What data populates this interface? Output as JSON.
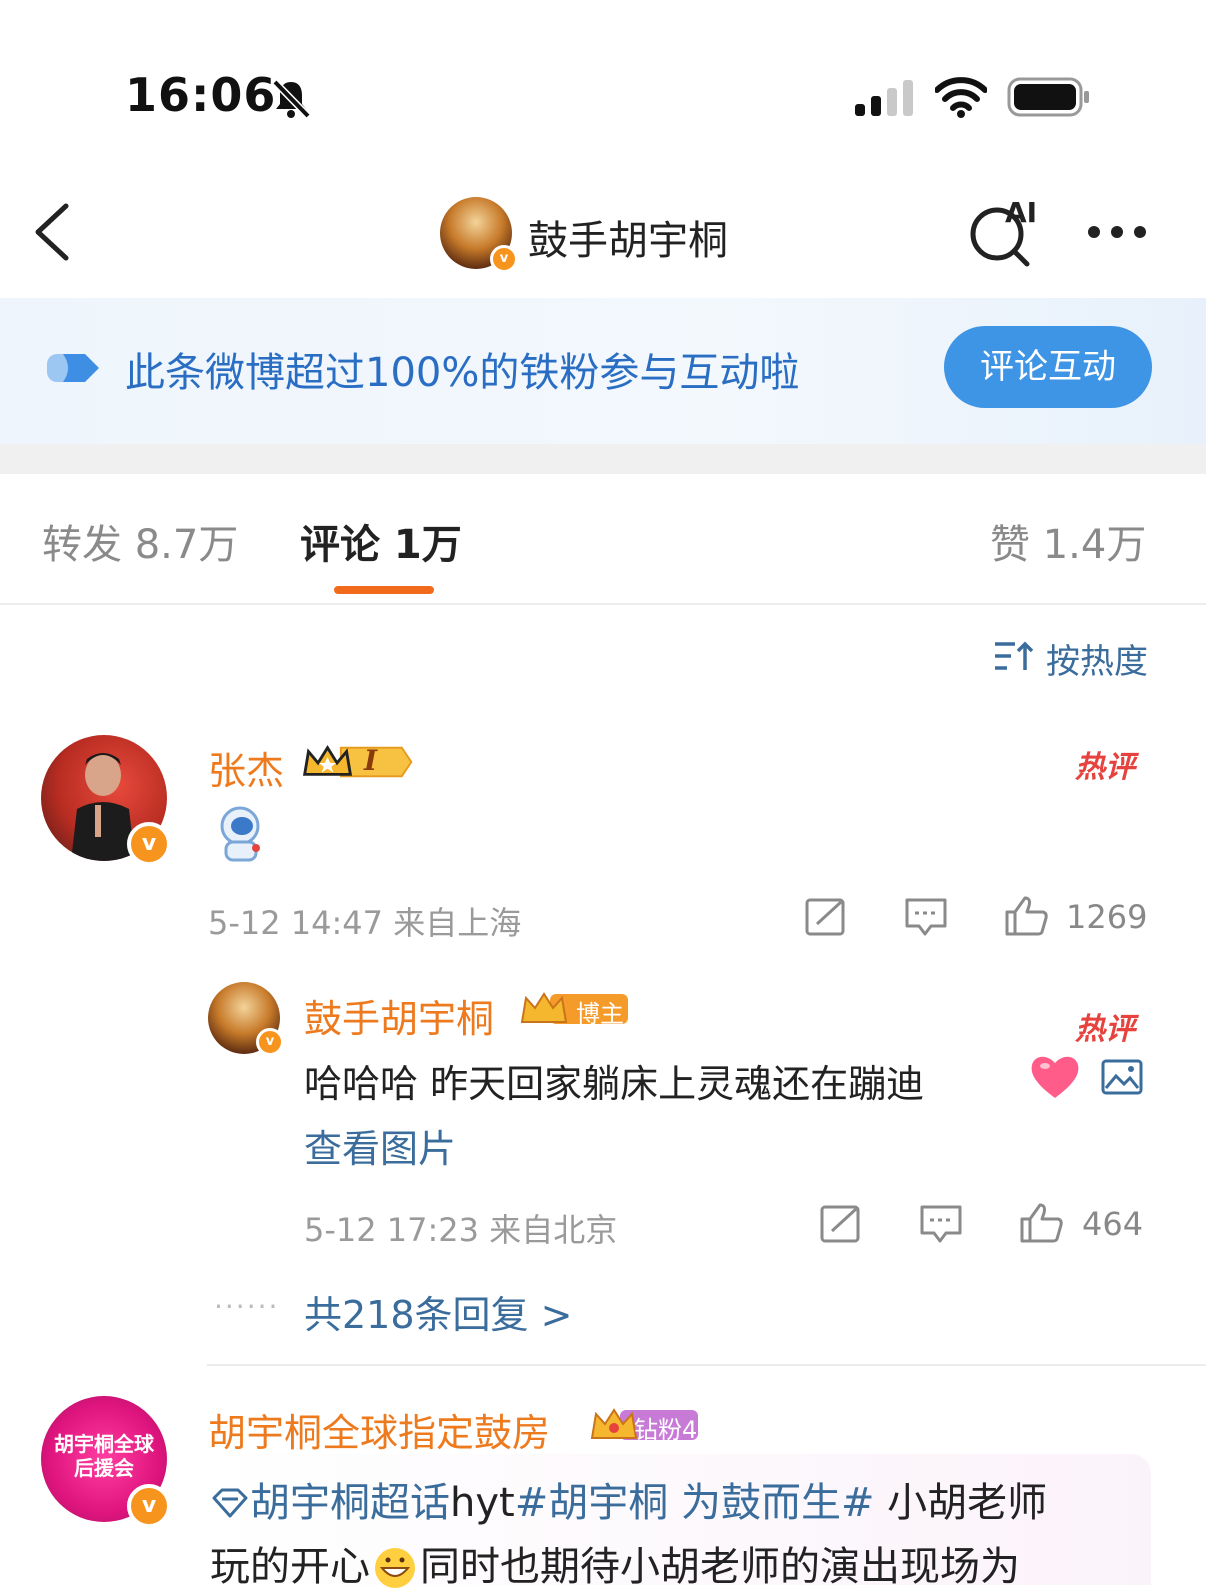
{
  "status_bar": {
    "time": "16:06"
  },
  "header": {
    "title": "鼓手胡宇桐",
    "ai_label": "AI"
  },
  "banner": {
    "text": "此条微博超过100%的铁粉参与互动啦",
    "button": "评论互动"
  },
  "tabs": {
    "repost": "转发 8.7万",
    "comments": "评论 1万",
    "likes": "赞 1.4万"
  },
  "sort": {
    "label": "按热度"
  },
  "comments": [
    {
      "name": "张杰",
      "level_badge": "I",
      "hot_tag": "热评",
      "time_loc": "5-12 14:47  来自上海",
      "likes": "1269",
      "reply": {
        "name": "鼓手胡宇桐",
        "badge": "博主",
        "hot_tag": "热评",
        "text": "哈哈哈 昨天回家躺床上灵魂还在蹦迪",
        "view_image": "查看图片",
        "time_loc": "5-12 17:23  来自北京",
        "likes": "464"
      },
      "dots": "······",
      "replies_link": "共218条回复 >"
    },
    {
      "name": "胡宇桐全球指定鼓房",
      "badge": "钻粉4",
      "avatar_text": "胡宇桐全球后援会",
      "topic_super": "胡宇桐超话",
      "topic_rest": "hyt",
      "hashtag": "#胡宇桐 为鼓而生#",
      "text_after_hashtag": " 小胡老师",
      "line2_start": "玩的开心",
      "line2_rest": "同时也期待小胡老师的演出现场为"
    }
  ],
  "colors": {
    "accent_orange": "#f26b1d",
    "name_orange": "#ee7a1e",
    "link_blue": "#3a6c9c",
    "button_blue": "#3e94e5",
    "hot_red": "#e6433f"
  }
}
